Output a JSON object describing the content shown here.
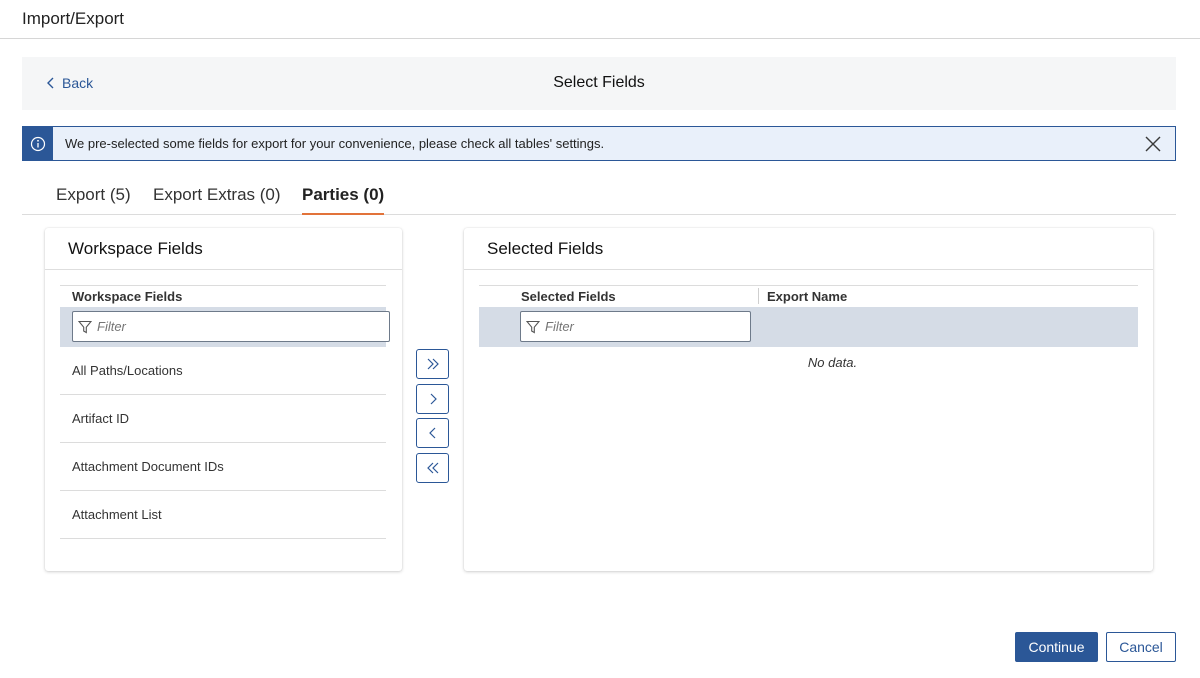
{
  "app": {
    "title": "Import/Export"
  },
  "subheader": {
    "back_label": "Back",
    "page_title": "Select Fields"
  },
  "banner": {
    "message": "We pre-selected some fields for export for your convenience, please check all tables' settings."
  },
  "tabs": [
    {
      "label": "Export (5)",
      "active": false
    },
    {
      "label": "Export Extras (0)",
      "active": false
    },
    {
      "label": "Parties (0)",
      "active": true
    }
  ],
  "workspace_panel": {
    "title": "Workspace Fields",
    "column_header": "Workspace Fields",
    "filter_placeholder": "Filter",
    "items": [
      "All Paths/Locations",
      "Artifact ID",
      "Attachment Document IDs",
      "Attachment List"
    ]
  },
  "selected_panel": {
    "title": "Selected Fields",
    "column_headers": [
      "Selected Fields",
      "Export Name"
    ],
    "filter_placeholder": "Filter",
    "empty_text": "No data."
  },
  "move_buttons": [
    "move-all-right",
    "move-right",
    "move-left",
    "move-all-left"
  ],
  "footer": {
    "continue_label": "Continue",
    "cancel_label": "Cancel"
  },
  "colors": {
    "accent": "#2b5797",
    "tab_underline": "#e2733a",
    "banner_bg": "#e9f0fa",
    "filter_row_bg": "#d5dce6"
  }
}
